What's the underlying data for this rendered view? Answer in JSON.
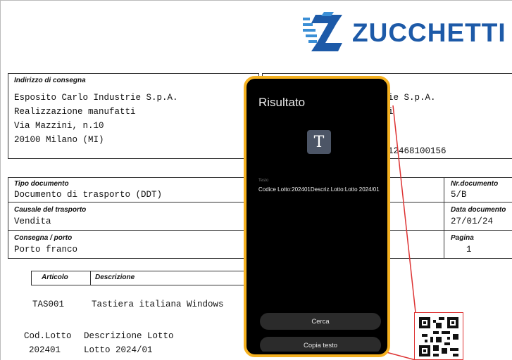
{
  "logo": {
    "text": "ZUCCHETTI",
    "color": "#1d5aa8"
  },
  "consegna": {
    "label": "Indirizzo di consegna",
    "lines": [
      "Esposito Carlo Industrie S.p.A.",
      "Realizzazione manufatti",
      "Via Mazzini, n.10",
      "20100 Milano (MI)"
    ]
  },
  "intestatario": {
    "partial_line1": "ie S.p.A.",
    "partial_line2": "i",
    "partial_code": "12468100156"
  },
  "tipo_documento": {
    "label": "Tipo documento",
    "value": "Documento di trasporto (DDT)"
  },
  "causale": {
    "label": "Causale del trasporto",
    "value": "Vendita"
  },
  "consegna_porto": {
    "label": "Consegna / porto",
    "value": "Porto franco"
  },
  "nr_documento": {
    "label": "Nr.documento",
    "value": "5/B"
  },
  "data_documento": {
    "label": "Data documento",
    "value": "27/01/24"
  },
  "pagina": {
    "label": "Pagina",
    "value": "1"
  },
  "articolo": {
    "col1": "Articolo",
    "col2": "Descrizione",
    "code": "TAS001",
    "desc": "Tastiera italiana Windows",
    "lot_hdr": "Cod.Lotto",
    "lot_desc_hdr": "Descrizione Lotto",
    "lot_code": "202401",
    "lot_desc": "Lotto 2024/01"
  },
  "phone": {
    "title": "Risultato",
    "icon": "text-T-icon",
    "testo_label": "Testo",
    "testo_value": "Codice Lotto:202401Descriz.Lotto:Lotto 2024/01",
    "btn_cerca": "Cerca",
    "btn_copia": "Copia testo",
    "frame_color": "#f5b120"
  }
}
